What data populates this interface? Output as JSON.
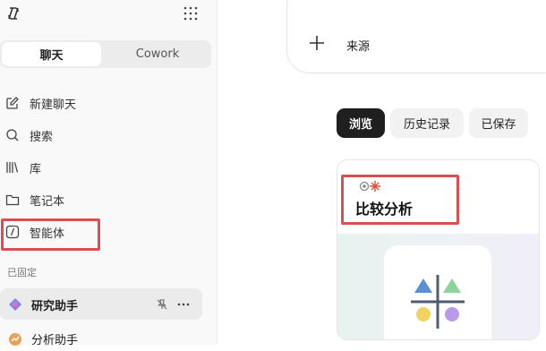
{
  "sidebar": {
    "logo_icon": "copilot-logo-icon",
    "apps_icon": "grid-dots-icon",
    "mode_tabs": [
      {
        "label": "聊天",
        "active": true
      },
      {
        "label": "Cowork",
        "active": false
      }
    ],
    "nav_items": [
      {
        "label": "新建聊天",
        "icon": "new-chat-icon"
      },
      {
        "label": "搜索",
        "icon": "search-icon"
      },
      {
        "label": "库",
        "icon": "library-icon"
      },
      {
        "label": "笔记本",
        "icon": "folder-icon"
      },
      {
        "label": "智能体",
        "icon": "agent-icon"
      }
    ],
    "pinned_section_label": "已固定",
    "pinned_items": [
      {
        "label": "研究助手",
        "icon": "research-agent-icon",
        "actions": [
          "unpin-icon",
          "more-icon"
        ]
      },
      {
        "label": "分析助手",
        "icon": "analyst-agent-icon"
      }
    ]
  },
  "main": {
    "composer": {
      "add_icon": "plus-icon",
      "source_label": "来源"
    },
    "tabs": [
      {
        "label": "浏览",
        "active": true
      },
      {
        "label": "历史记录",
        "active": false
      },
      {
        "label": "已保存",
        "active": false
      }
    ],
    "agent_card": {
      "title": "比较分析",
      "icon": "compare-analysis-icon"
    }
  },
  "colors": {
    "highlight": "#d94f4f",
    "active_tab": "#1f1f1f",
    "sidebar_bg": "#f9f9f9"
  }
}
